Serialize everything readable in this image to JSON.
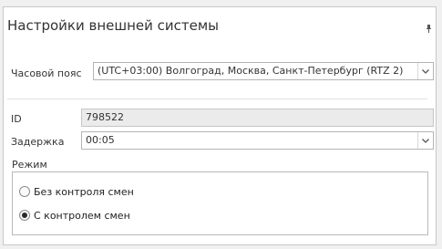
{
  "panel": {
    "title": "Настройки внешней системы",
    "pin_icon": "pin-icon"
  },
  "timezone": {
    "label": "Часовой пояс",
    "value": "(UTC+03:00) Волгоград, Москва, Санкт-Петербург (RTZ 2)"
  },
  "id_field": {
    "label": "ID",
    "value": "798522"
  },
  "delay": {
    "label": "Задержка",
    "value": "00:05"
  },
  "mode": {
    "label": "Режим",
    "options": [
      {
        "label": "Без контроля смен",
        "checked": false
      },
      {
        "label": "С контролем смен",
        "checked": true
      }
    ]
  }
}
